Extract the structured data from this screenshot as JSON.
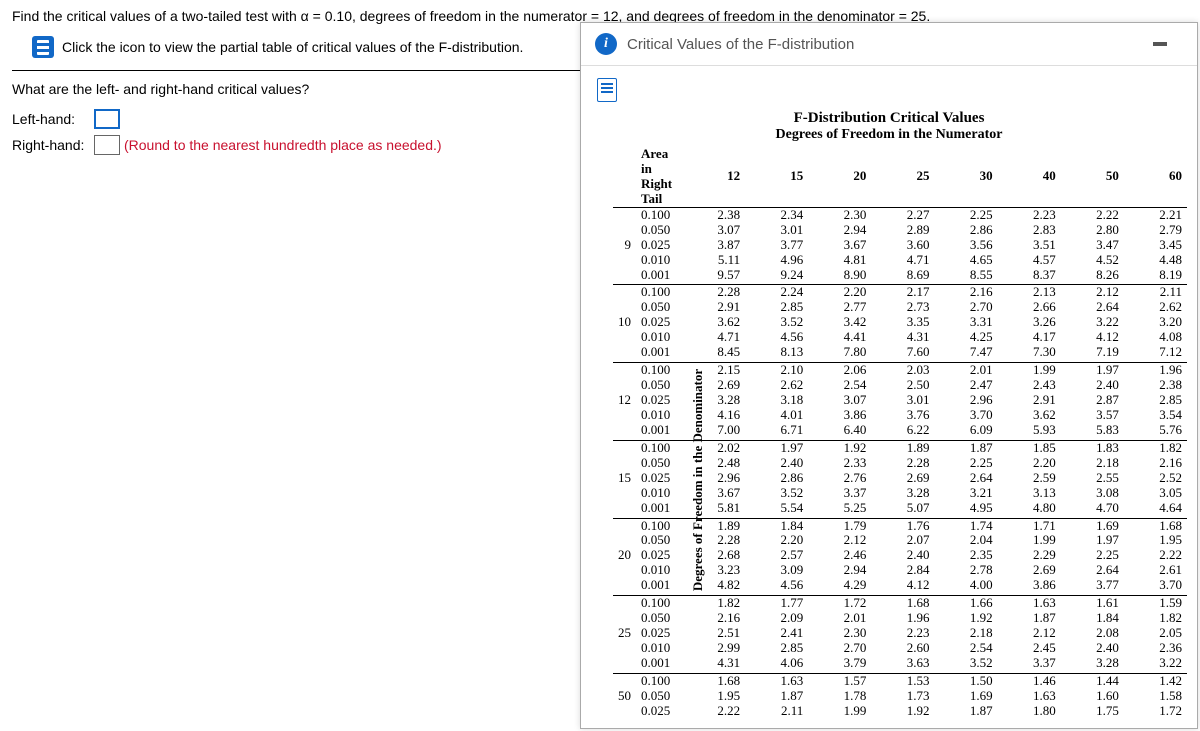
{
  "question": {
    "main_text": "Find the critical values of a two-tailed test with α = 0.10, degrees of freedom in the numerator = 12, and degrees of freedom in the denominator = 25.",
    "link_text": "Click the icon to view the partial table of critical values of the F-distribution.",
    "sub_text": "What are the left- and right-hand critical values?",
    "left_label": "Left-hand:",
    "right_label": "Right-hand:",
    "hint": "(Round to the nearest hundredth place as needed.)"
  },
  "modal": {
    "title": "Critical Values of the F-distribution",
    "heading1": "F-Distribution Critical Values",
    "heading2": "Degrees of Freedom in the Numerator",
    "area_head1": "Area in",
    "area_head2": "Right Tail",
    "yaxis": "Degrees of Freedom in the Denominator",
    "num_df": [
      "12",
      "15",
      "20",
      "25",
      "30",
      "40",
      "50",
      "60"
    ],
    "alphas": [
      "0.100",
      "0.050",
      "0.025",
      "0.010",
      "0.001"
    ],
    "blocks": [
      {
        "df": "9",
        "rows": [
          [
            "2.38",
            "2.34",
            "2.30",
            "2.27",
            "2.25",
            "2.23",
            "2.22",
            "2.21"
          ],
          [
            "3.07",
            "3.01",
            "2.94",
            "2.89",
            "2.86",
            "2.83",
            "2.80",
            "2.79"
          ],
          [
            "3.87",
            "3.77",
            "3.67",
            "3.60",
            "3.56",
            "3.51",
            "3.47",
            "3.45"
          ],
          [
            "5.11",
            "4.96",
            "4.81",
            "4.71",
            "4.65",
            "4.57",
            "4.52",
            "4.48"
          ],
          [
            "9.57",
            "9.24",
            "8.90",
            "8.69",
            "8.55",
            "8.37",
            "8.26",
            "8.19"
          ]
        ]
      },
      {
        "df": "10",
        "rows": [
          [
            "2.28",
            "2.24",
            "2.20",
            "2.17",
            "2.16",
            "2.13",
            "2.12",
            "2.11"
          ],
          [
            "2.91",
            "2.85",
            "2.77",
            "2.73",
            "2.70",
            "2.66",
            "2.64",
            "2.62"
          ],
          [
            "3.62",
            "3.52",
            "3.42",
            "3.35",
            "3.31",
            "3.26",
            "3.22",
            "3.20"
          ],
          [
            "4.71",
            "4.56",
            "4.41",
            "4.31",
            "4.25",
            "4.17",
            "4.12",
            "4.08"
          ],
          [
            "8.45",
            "8.13",
            "7.80",
            "7.60",
            "7.47",
            "7.30",
            "7.19",
            "7.12"
          ]
        ]
      },
      {
        "df": "12",
        "rows": [
          [
            "2.15",
            "2.10",
            "2.06",
            "2.03",
            "2.01",
            "1.99",
            "1.97",
            "1.96"
          ],
          [
            "2.69",
            "2.62",
            "2.54",
            "2.50",
            "2.47",
            "2.43",
            "2.40",
            "2.38"
          ],
          [
            "3.28",
            "3.18",
            "3.07",
            "3.01",
            "2.96",
            "2.91",
            "2.87",
            "2.85"
          ],
          [
            "4.16",
            "4.01",
            "3.86",
            "3.76",
            "3.70",
            "3.62",
            "3.57",
            "3.54"
          ],
          [
            "7.00",
            "6.71",
            "6.40",
            "6.22",
            "6.09",
            "5.93",
            "5.83",
            "5.76"
          ]
        ]
      },
      {
        "df": "15",
        "rows": [
          [
            "2.02",
            "1.97",
            "1.92",
            "1.89",
            "1.87",
            "1.85",
            "1.83",
            "1.82"
          ],
          [
            "2.48",
            "2.40",
            "2.33",
            "2.28",
            "2.25",
            "2.20",
            "2.18",
            "2.16"
          ],
          [
            "2.96",
            "2.86",
            "2.76",
            "2.69",
            "2.64",
            "2.59",
            "2.55",
            "2.52"
          ],
          [
            "3.67",
            "3.52",
            "3.37",
            "3.28",
            "3.21",
            "3.13",
            "3.08",
            "3.05"
          ],
          [
            "5.81",
            "5.54",
            "5.25",
            "5.07",
            "4.95",
            "4.80",
            "4.70",
            "4.64"
          ]
        ]
      },
      {
        "df": "20",
        "rows": [
          [
            "1.89",
            "1.84",
            "1.79",
            "1.76",
            "1.74",
            "1.71",
            "1.69",
            "1.68"
          ],
          [
            "2.28",
            "2.20",
            "2.12",
            "2.07",
            "2.04",
            "1.99",
            "1.97",
            "1.95"
          ],
          [
            "2.68",
            "2.57",
            "2.46",
            "2.40",
            "2.35",
            "2.29",
            "2.25",
            "2.22"
          ],
          [
            "3.23",
            "3.09",
            "2.94",
            "2.84",
            "2.78",
            "2.69",
            "2.64",
            "2.61"
          ],
          [
            "4.82",
            "4.56",
            "4.29",
            "4.12",
            "4.00",
            "3.86",
            "3.77",
            "3.70"
          ]
        ]
      },
      {
        "df": "25",
        "rows": [
          [
            "1.82",
            "1.77",
            "1.72",
            "1.68",
            "1.66",
            "1.63",
            "1.61",
            "1.59"
          ],
          [
            "2.16",
            "2.09",
            "2.01",
            "1.96",
            "1.92",
            "1.87",
            "1.84",
            "1.82"
          ],
          [
            "2.51",
            "2.41",
            "2.30",
            "2.23",
            "2.18",
            "2.12",
            "2.08",
            "2.05"
          ],
          [
            "2.99",
            "2.85",
            "2.70",
            "2.60",
            "2.54",
            "2.45",
            "2.40",
            "2.36"
          ],
          [
            "4.31",
            "4.06",
            "3.79",
            "3.63",
            "3.52",
            "3.37",
            "3.28",
            "3.22"
          ]
        ]
      },
      {
        "df": "50",
        "partial": true,
        "rows": [
          [
            "1.68",
            "1.63",
            "1.57",
            "1.53",
            "1.50",
            "1.46",
            "1.44",
            "1.42"
          ],
          [
            "1.95",
            "1.87",
            "1.78",
            "1.73",
            "1.69",
            "1.63",
            "1.60",
            "1.58"
          ],
          [
            "2.22",
            "2.11",
            "1.99",
            "1.92",
            "1.87",
            "1.80",
            "1.75",
            "1.72"
          ]
        ]
      }
    ]
  }
}
